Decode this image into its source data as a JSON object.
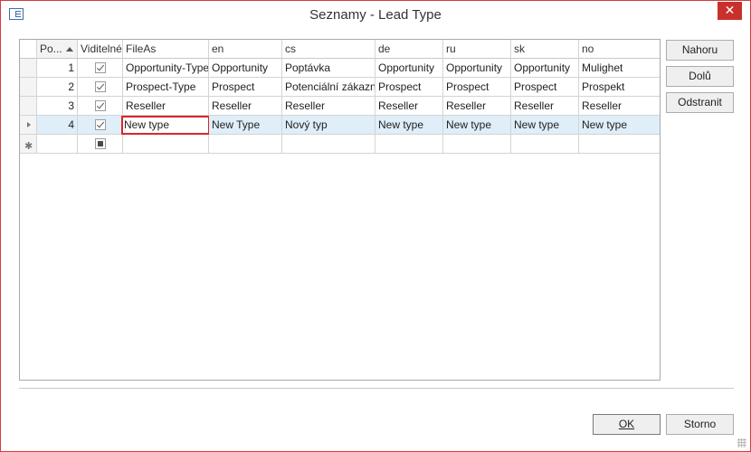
{
  "window": {
    "title": "Seznamy - Lead Type",
    "close_label": "✕"
  },
  "grid": {
    "columns": [
      "Po...",
      "Viditelné",
      "FileAs",
      "en",
      "cs",
      "de",
      "ru",
      "sk",
      "no"
    ],
    "rows": [
      {
        "num": "1",
        "visible": true,
        "cells": [
          "Opportunity-Type",
          "Opportunity",
          "Poptávka",
          "Opportunity",
          "Opportunity",
          "Opportunity",
          "Mulighet"
        ]
      },
      {
        "num": "2",
        "visible": true,
        "cells": [
          "Prospect-Type",
          "Prospect",
          "Potenciální zákazník",
          "Prospect",
          "Prospect",
          "Prospect",
          "Prospekt"
        ]
      },
      {
        "num": "3",
        "visible": true,
        "cells": [
          "Reseller",
          "Reseller",
          "Reseller",
          "Reseller",
          "Reseller",
          "Reseller",
          "Reseller"
        ]
      },
      {
        "num": "4",
        "visible": true,
        "cells": [
          "New type",
          "New Type",
          "Nový typ",
          "New type",
          "New type",
          "New type",
          "New type"
        ]
      }
    ],
    "new_row_marker": "✱"
  },
  "side_buttons": {
    "up": "Nahoru",
    "down": "Dolů",
    "remove": "Odstranit"
  },
  "footer": {
    "ok_label": "OK",
    "cancel_label": "Storno"
  },
  "colors": {
    "accent": "#c9302c",
    "selection": "#dfeef9",
    "edit_outline": "#d9262d"
  }
}
